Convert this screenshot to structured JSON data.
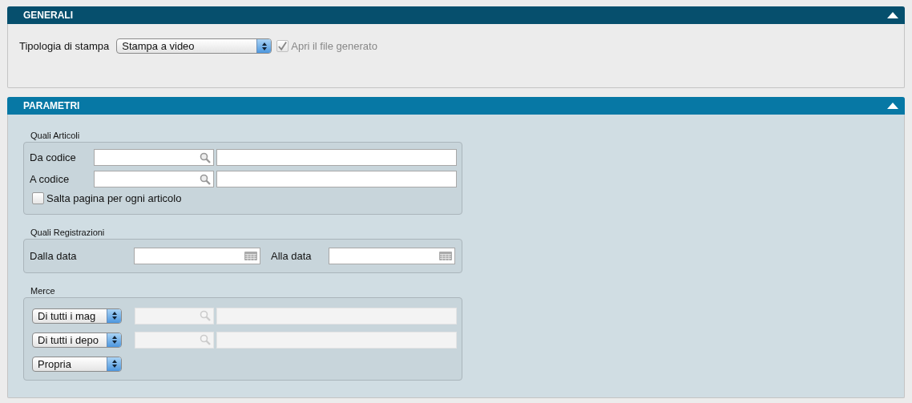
{
  "generali": {
    "title": "GENERALI",
    "color": "#064f6d",
    "expanded": true,
    "print_type": {
      "label": "Tipologia di stampa",
      "value": "Stampa a video"
    },
    "open_file": {
      "label": "Apri il file generato",
      "checked": true,
      "disabled": true
    }
  },
  "parametri": {
    "title": "PARAMETRI",
    "color": "#0778a5",
    "expanded": true,
    "articoli": {
      "legend": "Quali Articoli",
      "rows": [
        {
          "label": "Da codice"
        },
        {
          "label": "A codice"
        }
      ],
      "page_break": {
        "label": "Salta pagina per ogni articolo",
        "checked": false
      }
    },
    "registrazioni": {
      "legend": "Quali Registrazioni",
      "from_label": "Dalla data",
      "to_label": "Alla data"
    },
    "merce": {
      "legend": "Merce",
      "rows": [
        {
          "select": "Di tutti i mag",
          "kind": "lookup",
          "disabled": true
        },
        {
          "select": "Di tutti i depo",
          "kind": "lookup",
          "disabled": true
        },
        {
          "select": "Propria",
          "kind": "plain"
        }
      ]
    }
  }
}
